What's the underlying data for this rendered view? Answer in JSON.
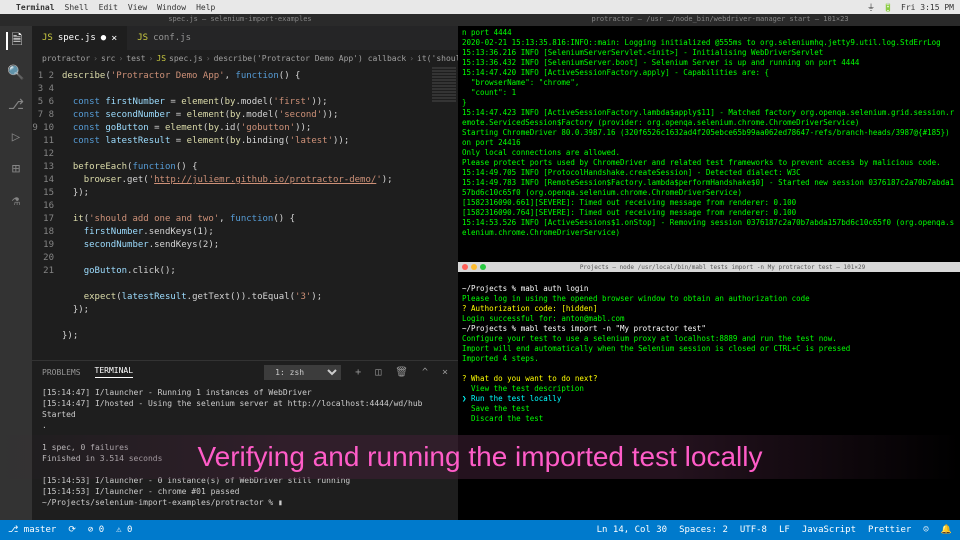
{
  "menubar": {
    "app": "Terminal",
    "items": [
      "Shell",
      "Edit",
      "View",
      "Window",
      "Help"
    ],
    "clock": "Fri 3:15 PM"
  },
  "window_titles": {
    "left": "spec.js — selenium-import-examples",
    "right": "protractor — /usr …/node_bin/webdriver-manager start — 101×23"
  },
  "tabs": [
    {
      "icon": "JS",
      "label": "spec.js",
      "active": true,
      "dirty": true
    },
    {
      "icon": "JS",
      "label": "conf.js",
      "active": false
    }
  ],
  "breadcrumb": [
    "protractor",
    "src",
    "test",
    "spec.js",
    "describe('Protractor Demo App') callback",
    "it('should add one an…"
  ],
  "code_lines": [
    "describe('Protractor Demo App', function() {",
    "",
    "  const firstNumber = element(by.model('first'));",
    "  const secondNumber = element(by.model('second'));",
    "  const goButton = element(by.id('gobutton'));",
    "  const latestResult = element(by.binding('latest'));",
    "",
    "  beforeEach(function() {",
    "    browser.get('http://juliemr.github.io/protractor-demo/');",
    "  });",
    "",
    "  it('should add one and two', function() {",
    "    firstNumber.sendKeys(1);",
    "    secondNumber.sendKeys(2);",
    "",
    "    goButton.click();",
    "",
    "    expect(latestResult.getText()).toEqual('3');",
    "  });",
    "",
    "});"
  ],
  "panel": {
    "tabs": [
      "PROBLEMS",
      "TERMINAL"
    ],
    "shell": "1: zsh",
    "output": "[15:14:47] I/launcher - Running 1 instances of WebDriver\n[15:14:47] I/hosted - Using the selenium server at http://localhost:4444/wd/hub\nStarted\n.\n\n1 spec, 0 failures\nFinished in 3.514 seconds\n\n[15:14:53] I/launcher - 0 instance(s) of WebDriver still running\n[15:14:53] I/launcher - chrome #01 passed\n~/Projects/selenium-import-examples/protractor % ▮"
  },
  "term_top": "n port 4444\n2020-02-21 15:13:35.816:INFO::main: Logging initialized @555ms to org.seleniumhq.jetty9.util.log.StdErrLog\n15:13:36.216 INFO [SeleniumServerServlet.<init>] - Initialising WebDriverServlet\n15:13:36.432 INFO [SeleniumServer.boot] - Selenium Server is up and running on port 4444\n15:14:47.420 INFO [ActiveSessionFactory.apply] - Capabilities are: {\n  \"browserName\": \"chrome\",\n  \"count\": 1\n}\n15:14:47.423 INFO [ActiveSessionFactory.lambda$apply$11] - Matched factory org.openqa.selenium.grid.session.remote.ServicedSession$Factory (provider: org.openqa.selenium.chrome.ChromeDriverService)\nStarting ChromeDriver 80.0.3987.16 (320f6526c1632ad4f205ebce65b99aa062ed78647-refs/branch-heads/3987@{#185}) on port 24416\nOnly local connections are allowed.\nPlease protect ports used by ChromeDriver and related test frameworks to prevent access by malicious code.\n15:14:49.705 INFO [ProtocolHandshake.createSession] - Detected dialect: W3C\n15:14:49.783 INFO [RemoteSession$Factory.lambda$performHandshake$0] - Started new session 0376187c2a70b7abda157bd6c10c65f0 (org.openqa.selenium.chrome.ChromeDriverService)\n[1582316090.661][SEVERE]: Timed out receiving message from renderer: 0.100\n[1582316090.764][SEVERE]: Timed out receiving message from renderer: 0.100\n15:14:53.526 INFO [ActiveSessions$1.onStop] - Removing session 0376187c2a70b7abda157bd6c10c65f0 (org.openqa.selenium.chrome.ChromeDriverService)",
  "term_bot_title": "Projects — node /usr/local/bin/mabl tests import -n My protractor test — 101×29",
  "term_bot": {
    "l1": "~/Projects % mabl auth login",
    "l2": "Please log in using the opened browser window to obtain an authorization code",
    "l3": "? Authorization code: [hidden]",
    "l4": "Login successful for: anton@mabl.com",
    "l5": "~/Projects % mabl tests import -n \"My protractor test\"",
    "l6": "Configure your test to use a selenium proxy at localhost:8889 and run the test now.",
    "l7": "Import will end automatically when the Selenium session is closed or CTRL+C is pressed",
    "l8": "Imported 4 steps.",
    "l9": "? What do you want to do next?",
    "l10": "  View the test description",
    "l11": "❯ Run the test locally",
    "l12": "  Save the test",
    "l13": "  Discard the test"
  },
  "statusbar": {
    "branch": "master",
    "sync": "⟳",
    "errors": "⊘ 0",
    "warnings": "⚠ 0",
    "cursor": "Ln 14, Col 30",
    "spaces": "Spaces: 2",
    "encoding": "UTF-8",
    "eol": "LF",
    "lang": "JavaScript",
    "formatter": "Prettier",
    "feedback": "☺"
  },
  "overlay": "Verifying and running the imported test locally"
}
